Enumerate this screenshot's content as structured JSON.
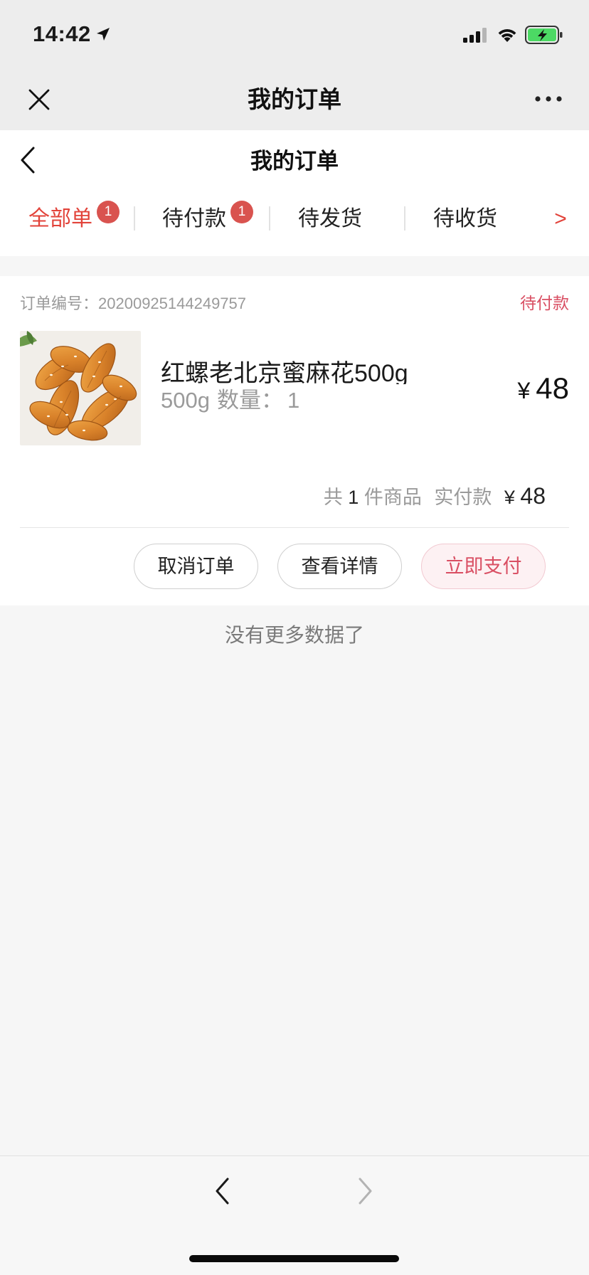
{
  "status_bar": {
    "time": "14:42",
    "location_icon": "location-arrow-icon",
    "signal_icon": "cellular-signal-icon",
    "wifi_icon": "wifi-icon",
    "battery_icon": "battery-charging-icon"
  },
  "wechat_nav": {
    "title": "我的订单",
    "close_icon": "close-icon",
    "more_icon": "more-dots-icon"
  },
  "page_header": {
    "title": "我的订单",
    "back_icon": "chevron-left-icon"
  },
  "tabs": [
    {
      "label": "全部单",
      "badge": "1",
      "active": true
    },
    {
      "label": "待付款",
      "badge": "1",
      "active": false
    },
    {
      "label": "待发货",
      "active": false
    },
    {
      "label": "待收货",
      "active": false
    }
  ],
  "tabs_more": ">",
  "order": {
    "number_label": "订单编号：",
    "number": "20200925144249757",
    "status": "待付款",
    "product": {
      "title": "红螺老北京蜜麻花500g",
      "spec": "500g",
      "qty_label": "数量：",
      "qty": "1",
      "price_symbol": "¥",
      "price": "48"
    },
    "summary": {
      "prefix": "共",
      "count": "1",
      "suffix": "件商品",
      "paid_label": "实付款",
      "currency": "¥",
      "total": "48"
    },
    "actions": {
      "cancel": "取消订单",
      "details": "查看详情",
      "pay": "立即支付"
    }
  },
  "footer_message": "没有更多数据了",
  "bottom_toolbar": {
    "back_icon": "chevron-left-icon",
    "forward_icon": "chevron-right-icon"
  },
  "colors": {
    "active_tab": "#e2433a",
    "badge": "#d9534f",
    "status_pink": "#d94f63",
    "pay_button_bg": "#fdf1f3",
    "nav_bg": "#ededed",
    "page_bg": "#f6f6f6"
  }
}
